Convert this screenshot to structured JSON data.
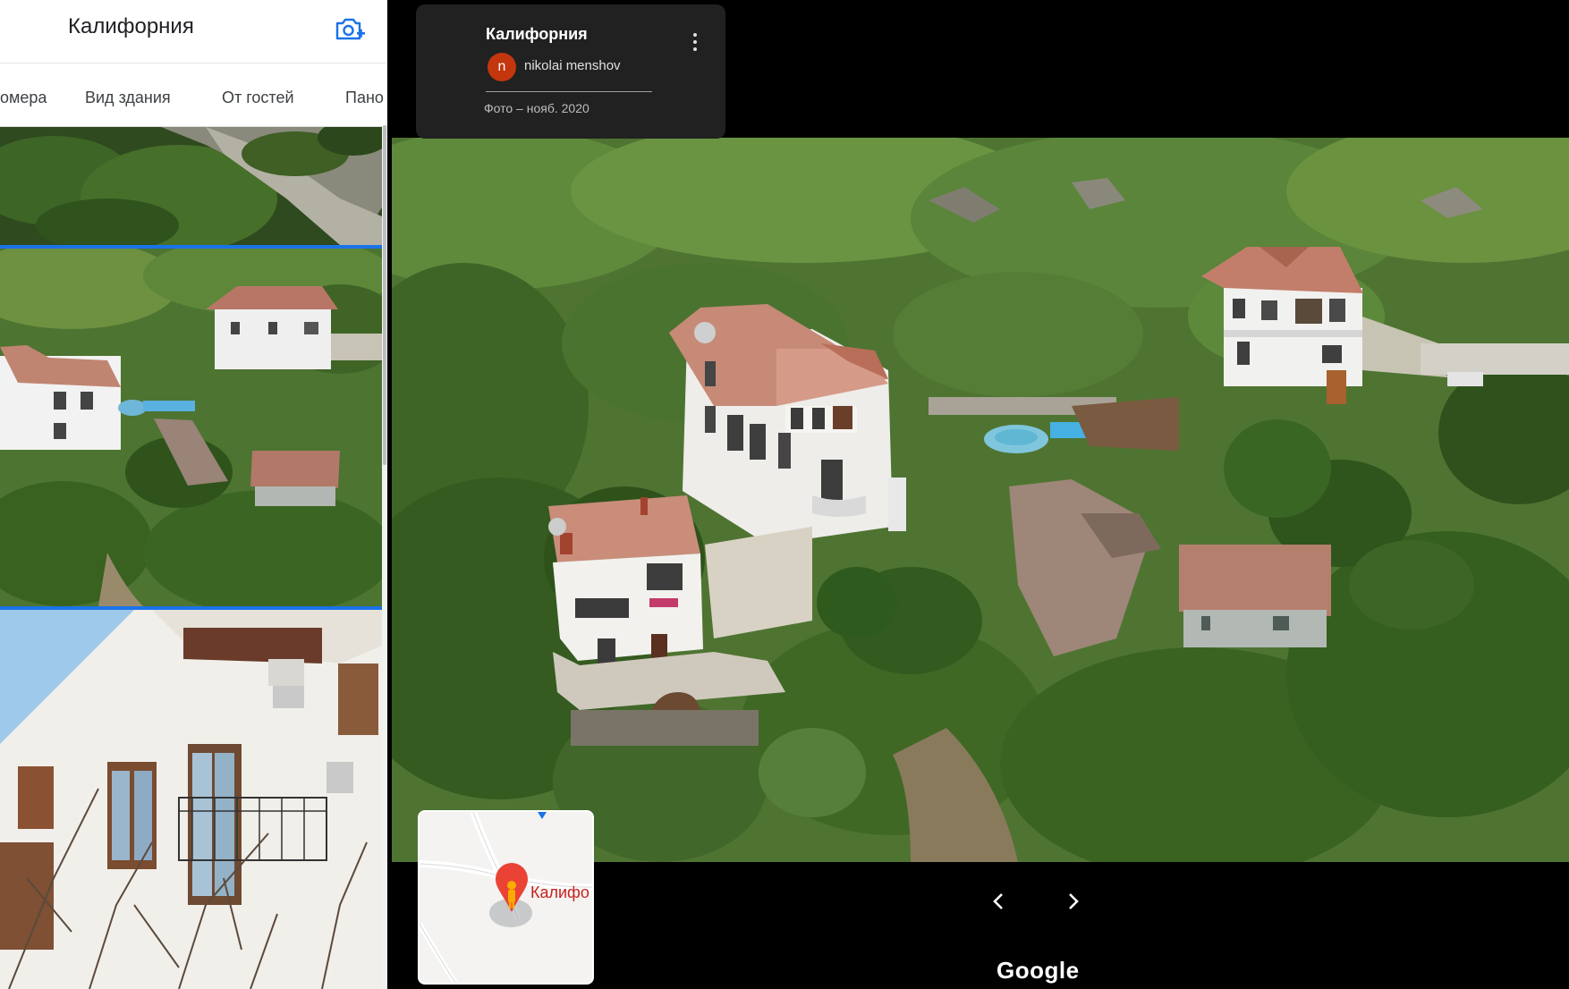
{
  "side_panel": {
    "title": "Калифорния",
    "tabs": [
      "омера",
      "Вид здания",
      "От гостей",
      "Пано"
    ],
    "thumbnails": [
      "aerial-hillside",
      "aerial-villas",
      "building-facade"
    ],
    "selected_thumbnail": 1
  },
  "photo_info": {
    "title": "Калифорния",
    "author_initial": "n",
    "author": "nikolai menshov",
    "date": "Фото – нояб. 2020"
  },
  "minimap": {
    "place_label": "Калифо"
  },
  "brand": "Google",
  "colors": {
    "accent_blue": "#1a73e8",
    "avatar": "#c3360e",
    "pin_red": "#ea4335",
    "pegman": "#f9ab00"
  }
}
